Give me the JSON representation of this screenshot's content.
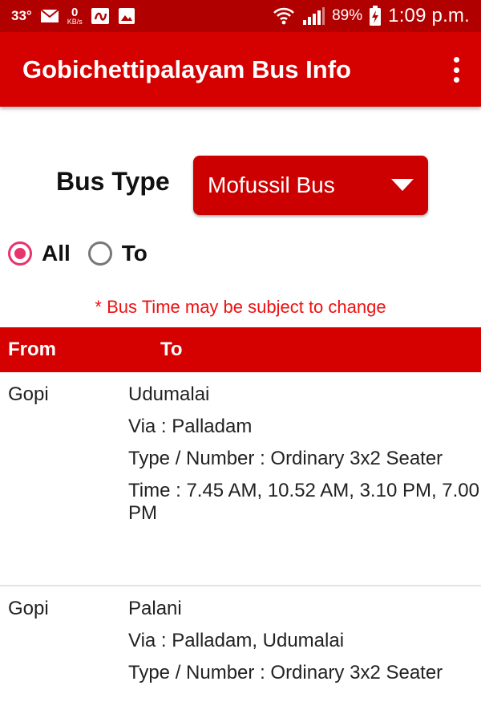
{
  "status_bar": {
    "temperature": "33°",
    "net_speed_value": "0",
    "net_speed_unit": "KB/s",
    "battery": "89%",
    "time": "1:09 p.m.",
    "icons": [
      "mail-icon",
      "app-icon",
      "image-icon",
      "wifi-icon",
      "signal-icon",
      "battery-charging-icon"
    ]
  },
  "app_bar": {
    "title": "Gobichettipalayam Bus Info",
    "menu_icon": "more-vert-icon"
  },
  "filter": {
    "bus_type_label": "Bus Type",
    "bus_type_selected": "Mofussil Bus",
    "radios": [
      {
        "label": "All",
        "checked": true
      },
      {
        "label": "To",
        "checked": false
      }
    ]
  },
  "note": "* Bus Time may be subject to change",
  "table": {
    "headers": {
      "from": "From",
      "to": "To"
    },
    "rows": [
      {
        "from": "Gopi",
        "to": "Udumalai",
        "via": "Via : Palladam",
        "type": "Type / Number :  Ordinary 3x2 Seater",
        "time": "Time : 7.45 AM,  10.52 AM,  3.10 PM, 7.00 PM"
      },
      {
        "from": "Gopi",
        "to": "Palani",
        "via": "Via : Palladam, Udumalai",
        "type": "Type / Number :  Ordinary 3x2 Seater"
      }
    ]
  },
  "colors": {
    "primary": "#d50000",
    "status_bar": "#b00000",
    "accent_radio": "#e8336d",
    "note_text": "#ee1111"
  }
}
